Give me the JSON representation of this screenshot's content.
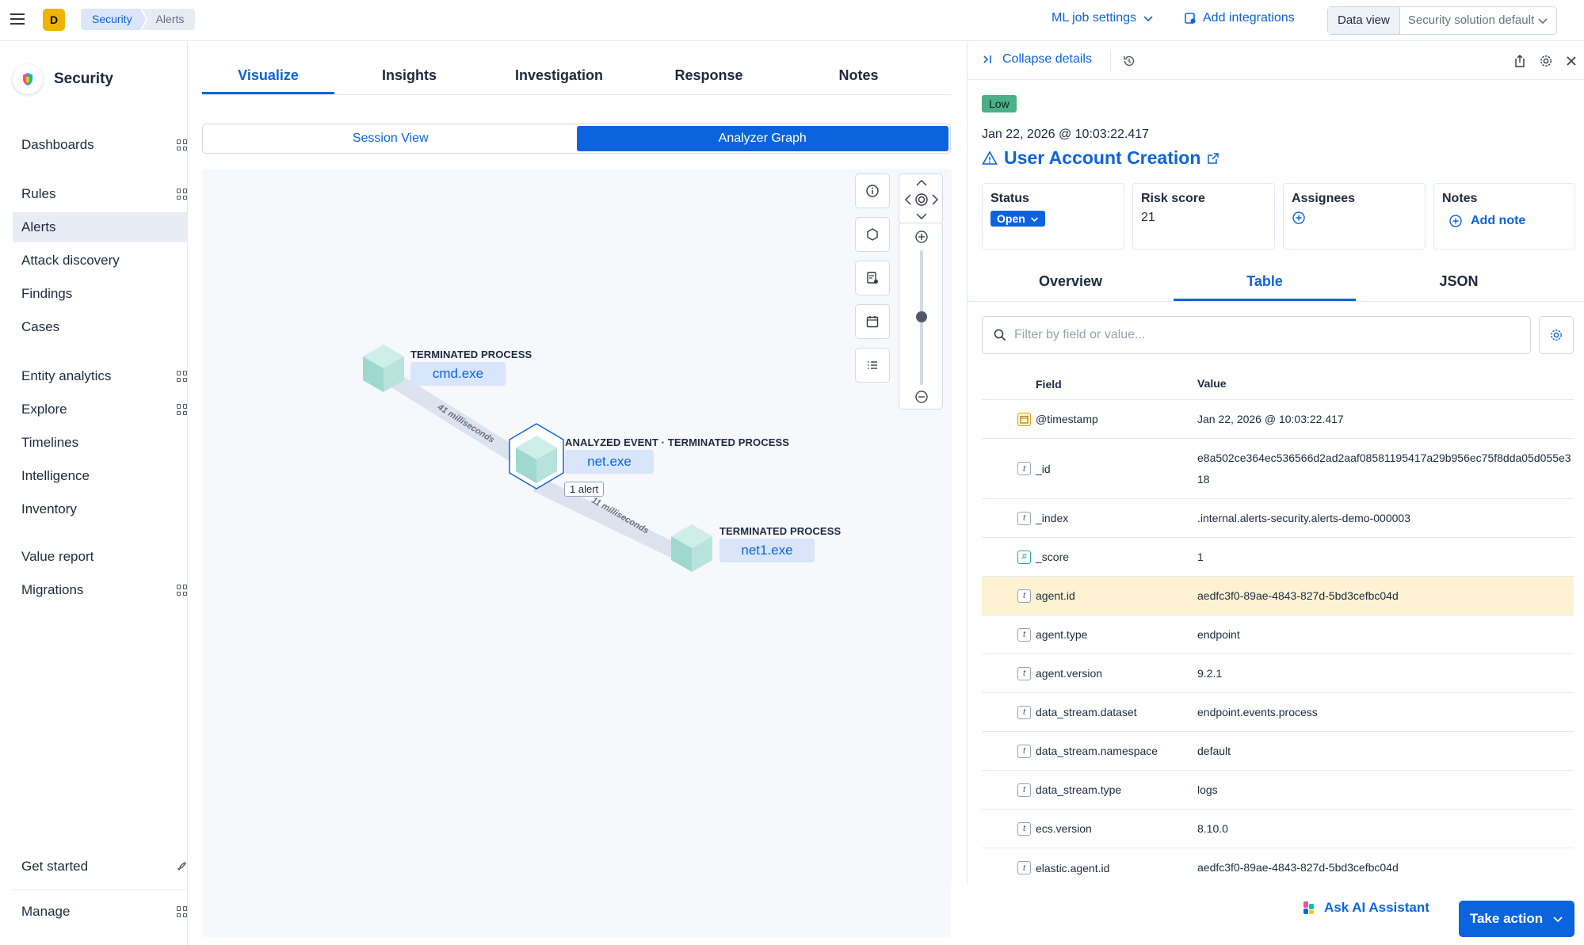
{
  "topbar": {
    "space_initial": "D",
    "breadcrumbs": [
      "Security",
      "Alerts"
    ],
    "ml_job_settings": "ML job settings",
    "add_integrations": "Add integrations",
    "data_view_label": "Data view",
    "data_view_value": "Security solution default"
  },
  "sidebar": {
    "title": "Security",
    "items": [
      {
        "label": "Dashboards"
      },
      {
        "label": "Rules"
      },
      {
        "label": "Alerts"
      },
      {
        "label": "Attack discovery"
      },
      {
        "label": "Findings"
      },
      {
        "label": "Cases"
      },
      {
        "label": "Entity analytics"
      },
      {
        "label": "Explore"
      },
      {
        "label": "Timelines"
      },
      {
        "label": "Intelligence"
      },
      {
        "label": "Inventory"
      },
      {
        "label": "Value report"
      },
      {
        "label": "Migrations"
      },
      {
        "label": "Get started"
      },
      {
        "label": "Manage"
      }
    ]
  },
  "main": {
    "tabs": [
      "Visualize",
      "Insights",
      "Investigation",
      "Response",
      "Notes"
    ],
    "view_toggle": [
      "Session View",
      "Analyzer Graph"
    ],
    "graph": {
      "nodes": [
        {
          "label": "TERMINATED PROCESS",
          "name": "cmd.exe"
        },
        {
          "label": "ANALYZED EVENT · TERMINATED PROCESS",
          "name": "net.exe"
        },
        {
          "label": "TERMINATED PROCESS",
          "name": "net1.exe"
        }
      ],
      "edges": [
        "41 milliseconds",
        "11 milliseconds"
      ],
      "alert_badge": "1 alert"
    }
  },
  "flyout": {
    "collapse_label": "Collapse details",
    "severity": "Low",
    "timestamp": "Jan 22, 2026 @ 10:03:22.417",
    "rule_name": "User Account Creation",
    "status_title": "Status",
    "status_value": "Open",
    "risk_title": "Risk score",
    "risk_value": "21",
    "assignees_title": "Assignees",
    "notes_title": "Notes",
    "add_note": "Add note",
    "tabs": [
      "Overview",
      "Table",
      "JSON"
    ],
    "search_placeholder": "Filter by field or value...",
    "table_headers": [
      "Field",
      "Value"
    ],
    "rows": [
      {
        "type": "date",
        "field": "@timestamp",
        "value": "Jan 22, 2026 @ 10:03:22.417"
      },
      {
        "type": "t",
        "field": "_id",
        "value": "e8a502ce364ec536566d2ad2aaf08581195417a29b956ec75f8dda05d055e318"
      },
      {
        "type": "t",
        "field": "_index",
        "value": ".internal.alerts-security.alerts-demo-000003"
      },
      {
        "type": "#",
        "field": "_score",
        "value": "1"
      },
      {
        "type": "t",
        "field": "agent.id",
        "value": "aedfc3f0-89ae-4843-827d-5bd3cefbc04d"
      },
      {
        "type": "t",
        "field": "agent.type",
        "value": "endpoint"
      },
      {
        "type": "t",
        "field": "agent.version",
        "value": "9.2.1"
      },
      {
        "type": "t",
        "field": "data_stream.dataset",
        "value": "endpoint.events.process"
      },
      {
        "type": "t",
        "field": "data_stream.namespace",
        "value": "default"
      },
      {
        "type": "t",
        "field": "data_stream.type",
        "value": "logs"
      },
      {
        "type": "t",
        "field": "ecs.version",
        "value": "8.10.0"
      },
      {
        "type": "t",
        "field": "elastic.agent.id",
        "value": "aedfc3f0-89ae-4843-827d-5bd3cefbc04d"
      }
    ]
  },
  "footer": {
    "ask_ai": "Ask AI Assistant",
    "take_action": "Take action"
  }
}
